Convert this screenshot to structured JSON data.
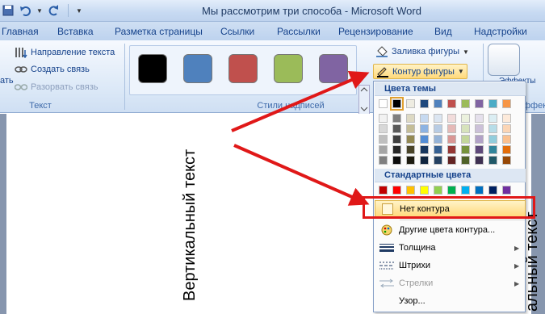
{
  "window": {
    "title": "Мы рассмотрим три способа - Microsoft Word"
  },
  "tabs": [
    "Главная",
    "Вставка",
    "Разметка страницы",
    "Ссылки",
    "Рассылки",
    "Рецензирование",
    "Вид",
    "Надстройки"
  ],
  "ribbon": {
    "text_group": {
      "label": "Текст",
      "direction": "Направление текста",
      "create_link": "Создать связь",
      "break_link": "Разорвать связь",
      "cut_left": "ать"
    },
    "styles_group": {
      "label": "Стили надписей",
      "swatch_colors": [
        "#000000",
        "#4f81bd",
        "#c0504d",
        "#9bbb59",
        "#8064a2"
      ]
    },
    "shape_fill": "Заливка фигуры",
    "shape_outline": "Контур фигуры",
    "effects_label": "Эффекты",
    "effects_cut": "ффекты"
  },
  "document": {
    "vertical_text": "Вертикальный текст",
    "vertical_text_cut": "альный текст"
  },
  "dropdown": {
    "theme_colors_header": "Цвета темы",
    "standard_colors_header": "Стандартные цвета",
    "no_outline": "Нет контура",
    "more_colors": "Другие цвета контура...",
    "weight": "Толщина",
    "dashes": "Штрихи",
    "arrows": "Стрелки",
    "pattern": "Узор...",
    "theme_top_row": [
      "#ffffff",
      "#000000",
      "#eeece1",
      "#1f497d",
      "#4f81bd",
      "#c0504d",
      "#9bbb59",
      "#8064a2",
      "#4bacc6",
      "#f79646"
    ],
    "theme_shades": [
      [
        "#f2f2f2",
        "#d8d8d8",
        "#bfbfbf",
        "#a5a5a5",
        "#7f7f7f"
      ],
      [
        "#7f7f7f",
        "#595959",
        "#3f3f3f",
        "#262626",
        "#0c0c0c"
      ],
      [
        "#ddd9c3",
        "#c4bd97",
        "#938953",
        "#494429",
        "#1d1b10"
      ],
      [
        "#c6d9f0",
        "#8db3e2",
        "#548dd4",
        "#17365d",
        "#0f243e"
      ],
      [
        "#dbe5f1",
        "#b8cce4",
        "#95b3d7",
        "#366092",
        "#244061"
      ],
      [
        "#f2dcdb",
        "#e5b9b7",
        "#d99694",
        "#953734",
        "#632423"
      ],
      [
        "#ebf1dd",
        "#d7e3bc",
        "#c3d69b",
        "#76923c",
        "#4f6128"
      ],
      [
        "#e5e0ec",
        "#ccc1d9",
        "#b2a2c7",
        "#5f497a",
        "#3f3151"
      ],
      [
        "#dbeef3",
        "#b7dde8",
        "#92cddc",
        "#31859b",
        "#205867"
      ],
      [
        "#fdeada",
        "#fbd5b5",
        "#fac08f",
        "#e36c09",
        "#974806"
      ]
    ],
    "standard_colors": [
      "#c00000",
      "#ff0000",
      "#ffc000",
      "#ffff00",
      "#92d050",
      "#00b050",
      "#00b0f0",
      "#0070c0",
      "#002060",
      "#7030a0"
    ]
  },
  "colors": {
    "annotation_red": "#e01818",
    "accent_blue": "#15428b"
  }
}
